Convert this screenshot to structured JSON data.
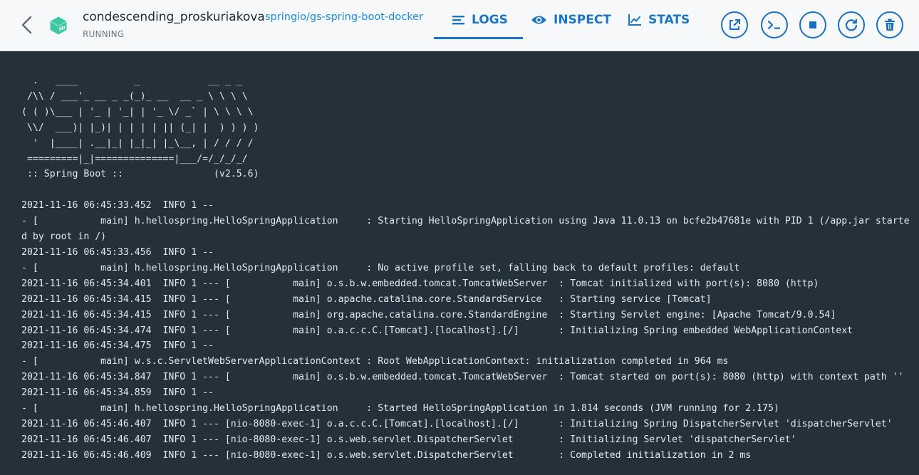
{
  "header": {
    "container_name": "condescending_proskuriakova",
    "status": "RUNNING",
    "image": "springio/gs-spring-boot-docker"
  },
  "tabs": [
    {
      "label": "LOGS",
      "icon": "lines-icon",
      "active": true
    },
    {
      "label": "INSPECT",
      "icon": "eye-icon",
      "active": false
    },
    {
      "label": "STATS",
      "icon": "chart-icon",
      "active": false
    }
  ],
  "actions": [
    {
      "name": "open-in-browser",
      "icon": "open-external-icon"
    },
    {
      "name": "cli",
      "icon": "terminal-icon"
    },
    {
      "name": "stop",
      "icon": "stop-icon"
    },
    {
      "name": "restart",
      "icon": "restart-icon"
    },
    {
      "name": "delete",
      "icon": "trash-icon"
    }
  ],
  "colors": {
    "accent": "#1a75c4",
    "log_background": "#25313a",
    "log_text": "#e4e9ed",
    "container_icon": "#3ec7a4"
  },
  "logs": [
    "  .   ____          _            __ _ _",
    " /\\\\ / ___'_ __ _ _(_)_ __  __ _ \\ \\ \\ \\",
    "( ( )\\___ | '_ | '_| | '_ \\/ _` | \\ \\ \\ \\",
    " \\\\/  ___)| |_)| | | | | || (_| |  ) ) ) )",
    "  '  |____| .__|_| |_|_| |_\\__, | / / / /",
    " =========|_|==============|___/=/_/_/_/",
    " :: Spring Boot ::                (v2.5.6)",
    "",
    "2021-11-16 06:45:33.452  INFO 1 --",
    "- [           main] h.hellospring.HelloSpringApplication     : Starting HelloSpringApplication using Java 11.0.13 on bcfe2b47681e with PID 1 (/app.jar starte",
    "d by root in /)",
    "2021-11-16 06:45:33.456  INFO 1 --",
    "- [           main] h.hellospring.HelloSpringApplication     : No active profile set, falling back to default profiles: default",
    "2021-11-16 06:45:34.401  INFO 1 --- [           main] o.s.b.w.embedded.tomcat.TomcatWebServer  : Tomcat initialized with port(s): 8080 (http)",
    "2021-11-16 06:45:34.415  INFO 1 --- [           main] o.apache.catalina.core.StandardService   : Starting service [Tomcat]",
    "2021-11-16 06:45:34.415  INFO 1 --- [           main] org.apache.catalina.core.StandardEngine  : Starting Servlet engine: [Apache Tomcat/9.0.54]",
    "2021-11-16 06:45:34.474  INFO 1 --- [           main] o.a.c.c.C.[Tomcat].[localhost].[/]       : Initializing Spring embedded WebApplicationContext",
    "2021-11-16 06:45:34.475  INFO 1 --",
    "- [           main] w.s.c.ServletWebServerApplicationContext : Root WebApplicationContext: initialization completed in 964 ms",
    "2021-11-16 06:45:34.847  INFO 1 --- [           main] o.s.b.w.embedded.tomcat.TomcatWebServer  : Tomcat started on port(s): 8080 (http) with context path ''",
    "2021-11-16 06:45:34.859  INFO 1 --",
    "- [           main] h.hellospring.HelloSpringApplication     : Started HelloSpringApplication in 1.814 seconds (JVM running for 2.175)",
    "2021-11-16 06:45:46.407  INFO 1 --- [nio-8080-exec-1] o.a.c.c.C.[Tomcat].[localhost].[/]       : Initializing Spring DispatcherServlet 'dispatcherServlet'",
    "2021-11-16 06:45:46.407  INFO 1 --- [nio-8080-exec-1] o.s.web.servlet.DispatcherServlet        : Initializing Servlet 'dispatcherServlet'",
    "2021-11-16 06:45:46.409  INFO 1 --- [nio-8080-exec-1] o.s.web.servlet.DispatcherServlet        : Completed initialization in 2 ms"
  ]
}
